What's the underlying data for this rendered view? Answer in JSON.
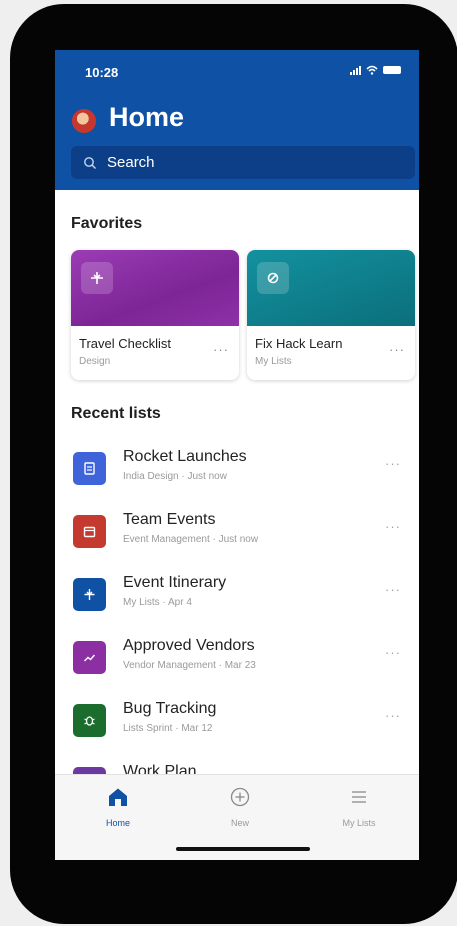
{
  "status": {
    "time": "10:28"
  },
  "header": {
    "title": "Home",
    "search_placeholder": "Search"
  },
  "favorites": {
    "title": "Favorites",
    "items": [
      {
        "name": "Travel Checklist",
        "subtitle": "Design",
        "color": "#8b2fa3",
        "icon": "airplane-icon"
      },
      {
        "name": "Fix Hack Learn",
        "subtitle": "My Lists",
        "color": "#0e7f8c",
        "icon": "wrench-icon"
      }
    ]
  },
  "recent": {
    "title": "Recent lists",
    "items": [
      {
        "name": "Rocket Launches",
        "subtitle": "India Design · Just now",
        "color": "#3f63d8",
        "icon": "list-icon"
      },
      {
        "name": "Team Events",
        "subtitle": "Event Management · Just now",
        "color": "#c53a2e",
        "icon": "calendar-icon"
      },
      {
        "name": "Event Itinerary",
        "subtitle": "My Lists · Apr 4",
        "color": "#0f52a5",
        "icon": "airplane-icon"
      },
      {
        "name": "Approved Vendors",
        "subtitle": "Vendor Management · Mar 23",
        "color": "#8b2fa3",
        "icon": "trend-icon"
      },
      {
        "name": "Bug Tracking",
        "subtitle": "Lists Sprint · Mar 12",
        "color": "#1b6d2e",
        "icon": "bug-icon"
      },
      {
        "name": "Work Plan",
        "subtitle": "",
        "color": "#6b3aa0",
        "icon": "list-icon"
      }
    ]
  },
  "tabs": [
    {
      "label": "Home",
      "icon": "home-icon"
    },
    {
      "label": "New",
      "icon": "plus-circle-icon"
    },
    {
      "label": "My Lists",
      "icon": "lines-icon"
    }
  ]
}
